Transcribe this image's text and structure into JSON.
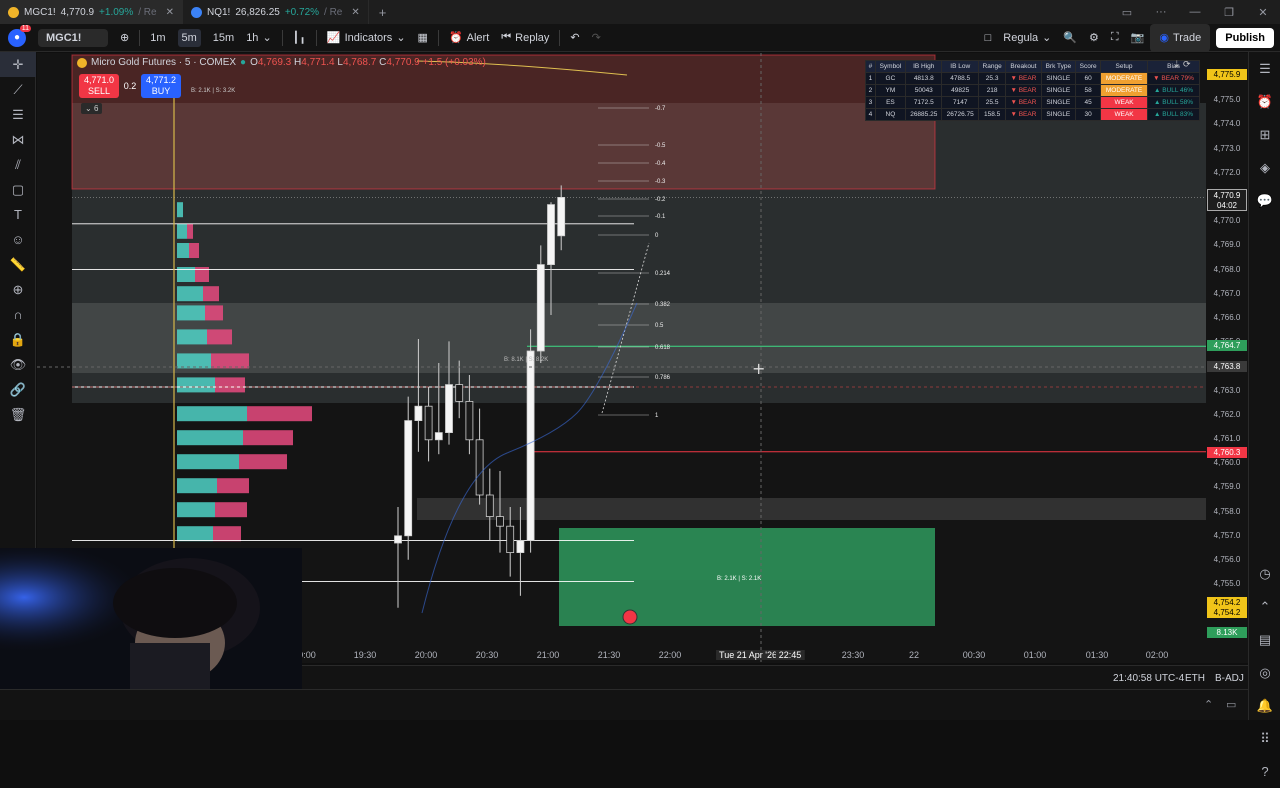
{
  "tabs": [
    {
      "symbol": "MGC1!",
      "price": "4,770.9",
      "change": "+1.09%",
      "suffix": "/ Re",
      "positive": true,
      "active": true
    },
    {
      "symbol": "NQ1!",
      "price": "26,826.25",
      "change": "+0.72%",
      "suffix": "/ Re",
      "positive": true,
      "active": false
    }
  ],
  "toolbar": {
    "avatar_badge": "11",
    "symbol": "MGC1!",
    "intervals": [
      "1m",
      "5m",
      "15m",
      "1h"
    ],
    "active_interval": "5m",
    "indicators_label": "Indicators",
    "alert_label": "Alert",
    "replay_label": "Replay",
    "layout_label": "Regula",
    "trade_label": "Trade",
    "publish_label": "Publish"
  },
  "legend": {
    "title": "Micro Gold Futures · 5 · COMEX",
    "o": "4,769.3",
    "h": "4,771.4",
    "l": "4,768.7",
    "c": "4,770.9",
    "chg": "+1.5 (+0.03%)",
    "sell_price": "4,771.0",
    "sell_label": "SELL",
    "spread": "0.2",
    "buy_price": "4,771.2",
    "buy_label": "BUY",
    "collapsed_count": "6",
    "volume_text": "B: 2.1K | S: 3.2K"
  },
  "stat_table": {
    "headers": [
      "#",
      "Symbol",
      "IB High",
      "IB Low",
      "Range",
      "Breakout",
      "Brk Type",
      "Score",
      "Setup",
      "Bias"
    ],
    "rows": [
      [
        "1",
        "GC",
        "4813.8",
        "4788.5",
        "25.3",
        "▼ BEAR",
        "SINGLE",
        "60",
        "MODERATE",
        "▼ BEAR 79%"
      ],
      [
        "2",
        "YM",
        "50043",
        "49825",
        "218",
        "▼ BEAR",
        "SINGLE",
        "58",
        "MODERATE",
        "▲ BULL 46%"
      ],
      [
        "3",
        "ES",
        "7172.5",
        "7147",
        "25.5",
        "▼ BEAR",
        "SINGLE",
        "45",
        "WEAK",
        "▲ BULL 58%"
      ],
      [
        "4",
        "NQ",
        "26885.25",
        "26726.75",
        "158.5",
        "▼ BEAR",
        "SINGLE",
        "30",
        "WEAK",
        "▲ BULL 83%"
      ]
    ]
  },
  "fib_levels": [
    "-0.7",
    "-0.5",
    "-0.4",
    "-0.3",
    "-0.2",
    "-0.1",
    "0",
    "0.214",
    "0.382",
    "0.5",
    "0.618",
    "0.786",
    "1"
  ],
  "zone_labels": {
    "mid": "B: 8.1K | S: 8.2K",
    "green": "B: 2.1K | S: 2.1K"
  },
  "price_axis": [
    "4,776.0",
    "4,775.0",
    "4,774.0",
    "4,773.0",
    "4,772.0",
    "4,771.0",
    "4,770.0",
    "4,769.0",
    "4,768.0",
    "4,767.0",
    "4,766.0",
    "4,765.0",
    "4,764.0",
    "4,763.0",
    "4,762.0",
    "4,761.0",
    "4,760.0",
    "4,759.0",
    "4,758.0",
    "4,757.0",
    "4,756.0",
    "4,755.0",
    "4,754.0"
  ],
  "price_tags": {
    "top": "4,775.9",
    "last": "4,770.9",
    "countdown": "04:02",
    "green": "4,764.7",
    "cross": "4,763.8",
    "red": "4,760.3",
    "yellow1": "4,754.2",
    "yellow2": "4,754.2",
    "volume": "8.13K"
  },
  "time_axis": [
    "9:00",
    "19:30",
    "20:00",
    "20:30",
    "21:00",
    "21:30",
    "22:00",
    "Tue 21 Apr '26",
    "22:45",
    "23:30",
    "22",
    "00:30",
    "01:00",
    "01:30",
    "02:00"
  ],
  "status": {
    "clock": "21:40:58 UTC-4",
    "session": "ETH",
    "adj": "B-ADJ"
  },
  "colors": {
    "bull": "#26a69a",
    "bear": "#ef5350",
    "accent": "#2962ff",
    "profile_buy": "#4fd1c5",
    "profile_sell": "#e84a7f",
    "zone_red": "#f23645",
    "zone_green": "#3ddc84"
  },
  "chart_data": {
    "type": "candlestick",
    "note_series": "5-minute candles, prices in USD",
    "candles": [
      {
        "time": "20:00",
        "o": 4756.5,
        "h": 4758.0,
        "l": 4753.8,
        "c": 4756.8
      },
      {
        "time": "20:05",
        "o": 4756.8,
        "h": 4762.6,
        "l": 4755.8,
        "c": 4761.6
      },
      {
        "time": "20:10",
        "o": 4761.6,
        "h": 4765.0,
        "l": 4760.3,
        "c": 4762.2
      },
      {
        "time": "20:15",
        "o": 4762.2,
        "h": 4763.0,
        "l": 4759.9,
        "c": 4760.8
      },
      {
        "time": "20:20",
        "o": 4760.8,
        "h": 4764.0,
        "l": 4760.2,
        "c": 4761.1
      },
      {
        "time": "20:25",
        "o": 4761.1,
        "h": 4764.9,
        "l": 4760.6,
        "c": 4763.1
      },
      {
        "time": "20:30",
        "o": 4763.1,
        "h": 4764.1,
        "l": 4761.7,
        "c": 4762.4
      },
      {
        "time": "20:35",
        "o": 4762.4,
        "h": 4763.5,
        "l": 4760.2,
        "c": 4760.8
      },
      {
        "time": "20:40",
        "o": 4760.8,
        "h": 4762.1,
        "l": 4758.1,
        "c": 4758.5
      },
      {
        "time": "20:45",
        "o": 4758.5,
        "h": 4759.6,
        "l": 4756.6,
        "c": 4757.6
      },
      {
        "time": "20:50",
        "o": 4757.6,
        "h": 4759.5,
        "l": 4756.1,
        "c": 4757.2
      },
      {
        "time": "20:55",
        "o": 4757.2,
        "h": 4758.0,
        "l": 4755.1,
        "c": 4756.1
      },
      {
        "time": "21:00",
        "o": 4756.1,
        "h": 4758.0,
        "l": 4754.3,
        "c": 4756.6
      },
      {
        "time": "21:05",
        "o": 4756.6,
        "h": 4765.4,
        "l": 4756.1,
        "c": 4764.5
      },
      {
        "time": "21:10",
        "o": 4764.5,
        "h": 4768.9,
        "l": 4764.0,
        "c": 4768.1
      },
      {
        "time": "21:15",
        "o": 4768.1,
        "h": 4770.7,
        "l": 4766.0,
        "c": 4770.6
      },
      {
        "time": "21:20",
        "o": 4769.3,
        "h": 4771.4,
        "l": 4768.7,
        "c": 4770.9
      }
    ],
    "ylim": [
      4753.5,
      4776.5
    ]
  }
}
